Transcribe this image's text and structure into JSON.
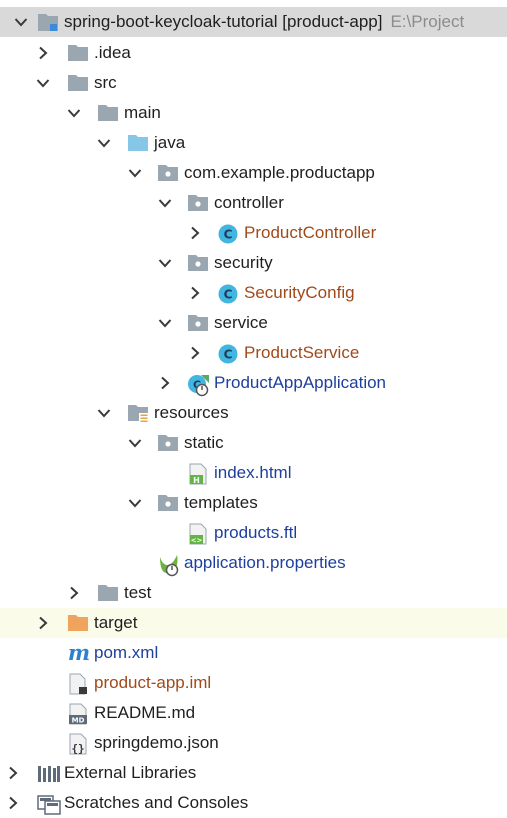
{
  "tree": {
    "root": {
      "name": "spring-boot-keycloak-tutorial",
      "module": "[product-app]",
      "path": "E:\\Project"
    },
    "idea": "idea",
    "src": "src",
    "main": "main",
    "java": "java",
    "package": "com.example.productapp",
    "controller": "controller",
    "product_controller": "ProductController",
    "security": "security",
    "security_config": "SecurityConfig",
    "service": "service",
    "product_service": "ProductService",
    "product_app_application": "ProductAppApplication",
    "resources": "resources",
    "static": "static",
    "index_html": "index.html",
    "templates": "templates",
    "products_ftl": "products.ftl",
    "application_properties": "application.properties",
    "test": "test",
    "target": "target",
    "pom": "pom.xml",
    "iml": "product-app.iml",
    "readme": "README.md",
    "springdemo": "springdemo.json",
    "external_libraries": "External Libraries",
    "scratches": "Scratches and Consoles"
  },
  "colors": {
    "selected_row": "#d9d9d9",
    "highlight_row": "#fbfbe9",
    "class_name": "#a04a1a",
    "file_name": "#1d3f9e",
    "folder": "#9aa7b0",
    "java_folder": "#86c6e6",
    "excluded_folder": "#f0a35d",
    "class_icon": "#40b6e0"
  },
  "icons": {
    "collapsed": "chevron-right-icon",
    "expanded": "chevron-down-icon",
    "folder": "folder-icon",
    "package": "package-icon",
    "class": "class-icon",
    "spring_app": "spring-boot-app-icon",
    "resources": "resources-folder-icon",
    "html": "html-file-icon",
    "template": "template-file-icon",
    "properties": "spring-properties-icon",
    "excluded": "excluded-folder-icon",
    "maven": "maven-icon",
    "iml": "iml-file-icon",
    "markdown": "markdown-icon",
    "json": "json-icon",
    "libraries": "libraries-icon",
    "scratches": "scratches-icon"
  }
}
